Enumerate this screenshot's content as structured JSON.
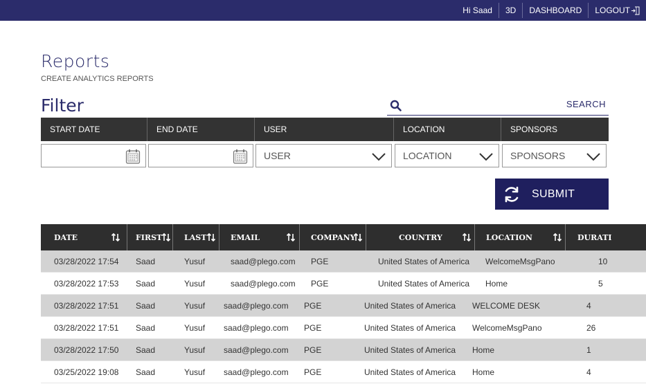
{
  "header": {
    "greeting": "Hi Saad",
    "nav_3d": "3D",
    "nav_dashboard": "DASHBOARD",
    "nav_logout": "LOGOUT",
    "bar_color": "#2b2c6b"
  },
  "page": {
    "title": "Reports",
    "subtitle": "CREATE ANALYTICS REPORTS",
    "filter_title": "Filter"
  },
  "search": {
    "label": "SEARCH",
    "value": ""
  },
  "filter": {
    "headers": [
      "START DATE",
      "END DATE",
      "USER",
      "LOCATION",
      "SPONSORS"
    ],
    "start_date": "",
    "end_date": "",
    "user_selected": "USER",
    "location_selected": "LOCATION",
    "sponsors_selected": "SPONSORS"
  },
  "submit": {
    "label": "SUBMIT",
    "icon": "refresh-icon",
    "color": "#1f1f5e"
  },
  "table": {
    "columns": [
      "DATE",
      "FIRST",
      "LAST",
      "EMAIL",
      "COMPANY",
      "COUNTRY",
      "LOCATION",
      "DURATI"
    ],
    "rows": [
      [
        "03/28/2022 17:54",
        "Saad",
        "Yusuf",
        "saad@plego.com",
        "PGE",
        "United States of America",
        "WelcomeMsgPano",
        "10"
      ],
      [
        "03/28/2022 17:53",
        "Saad",
        "Yusuf",
        "saad@plego.com",
        "PGE",
        "United States of America",
        "Home",
        "5"
      ],
      [
        "03/28/2022 17:51",
        "Saad",
        "Yusuf",
        "saad@plego.com",
        "PGE",
        "United States of America",
        "WELCOME DESK",
        "4"
      ],
      [
        "03/28/2022 17:51",
        "Saad",
        "Yusuf",
        "saad@plego.com",
        "PGE",
        "United States of America",
        "WelcomeMsgPano",
        "26"
      ],
      [
        "03/28/2022 17:50",
        "Saad",
        "Yusuf",
        "saad@plego.com",
        "PGE",
        "United States of America",
        "Home",
        "1"
      ],
      [
        "03/25/2022 19:08",
        "Saad",
        "Yusuf",
        "saad@plego.com",
        "PGE",
        "United States of America",
        "Home",
        "4"
      ]
    ]
  }
}
